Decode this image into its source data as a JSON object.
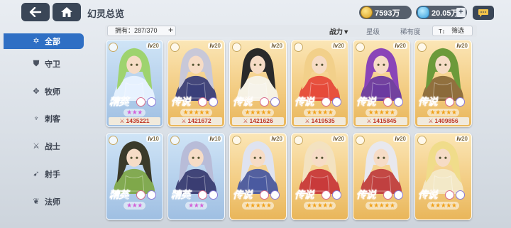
{
  "header": {
    "title": "幻灵总览",
    "gold": "7593万",
    "gems": "20.05万",
    "plus": "+"
  },
  "sidebar": {
    "items": [
      {
        "label": "全部",
        "icon": "all-star-icon",
        "active": true
      },
      {
        "label": "守卫",
        "icon": "shield-icon",
        "active": false
      },
      {
        "label": "牧师",
        "icon": "priest-icon",
        "active": false
      },
      {
        "label": "刺客",
        "icon": "assassin-icon",
        "active": false
      },
      {
        "label": "战士",
        "icon": "warrior-icon",
        "active": false
      },
      {
        "label": "射手",
        "icon": "archer-icon",
        "active": false
      },
      {
        "label": "法师",
        "icon": "mage-icon",
        "active": false
      }
    ]
  },
  "filterbar": {
    "owned": "拥有：287/370",
    "owned_plus": "+",
    "tabs": [
      {
        "label": "战力▼",
        "selected": true
      },
      {
        "label": "星级",
        "selected": false
      },
      {
        "label": "稀有度",
        "selected": false
      }
    ],
    "filter_label": "筛选",
    "filter_icon": "filter-icon"
  },
  "cards": [
    {
      "rank": "精英",
      "tier": "elite",
      "lv_prefix": "lv",
      "level": "20",
      "stars": "★★★",
      "power": "1435221",
      "colors": {
        "hair": "#9ed36f",
        "cloth": "#e8f2ff"
      }
    },
    {
      "rank": "传说",
      "tier": "legend",
      "lv_prefix": "lv",
      "level": "20",
      "stars": "★★★★★",
      "power": "1421672",
      "colors": {
        "hair": "#c8c8d8",
        "cloth": "#3a3f7a"
      }
    },
    {
      "rank": "传说",
      "tier": "legend",
      "lv_prefix": "lv",
      "level": "20",
      "stars": "★★★★★",
      "power": "1421626",
      "colors": {
        "hair": "#2a2a2a",
        "cloth": "#f6f3ea"
      }
    },
    {
      "rank": "传说",
      "tier": "legend",
      "lv_prefix": "lv",
      "level": "20",
      "stars": "★★★★★",
      "power": "1419535",
      "colors": {
        "hair": "#f2d08a",
        "cloth": "#e64a3a"
      }
    },
    {
      "rank": "传说",
      "tier": "legend",
      "lv_prefix": "lv",
      "level": "20",
      "stars": "★★★★★",
      "power": "1415845",
      "colors": {
        "hair": "#8a44b8",
        "cloth": "#6b3aa0"
      }
    },
    {
      "rank": "传说",
      "tier": "legend",
      "lv_prefix": "lv",
      "level": "20",
      "stars": "★★★★★",
      "power": "1409856",
      "colors": {
        "hair": "#6c9a3a",
        "cloth": "#8b6a3a"
      }
    },
    {
      "rank": "精英",
      "tier": "elite",
      "lv_prefix": "lv",
      "level": "10",
      "stars": "★★★",
      "power": "",
      "colors": {
        "hair": "#3a3a2a",
        "cloth": "#7fa84a"
      }
    },
    {
      "rank": "精英",
      "tier": "elite",
      "lv_prefix": "lv",
      "level": "10",
      "stars": "★★★",
      "power": "",
      "colors": {
        "hair": "#b8bcd8",
        "cloth": "#3a3d72"
      }
    },
    {
      "rank": "传说",
      "tier": "legend",
      "lv_prefix": "lv",
      "level": "20",
      "stars": "★★★★★",
      "power": "",
      "colors": {
        "hair": "#dfe3f0",
        "cloth": "#4a5aa0"
      }
    },
    {
      "rank": "传说",
      "tier": "legend",
      "lv_prefix": "lv",
      "level": "20",
      "stars": "★★★★★",
      "power": "",
      "colors": {
        "hair": "#f3e2c0",
        "cloth": "#c83a3a"
      }
    },
    {
      "rank": "传说",
      "tier": "legend",
      "lv_prefix": "lv",
      "level": "20",
      "stars": "★★★★★",
      "power": "",
      "colors": {
        "hair": "#e8e8ee",
        "cloth": "#c04040"
      }
    },
    {
      "rank": "传说",
      "tier": "legend",
      "lv_prefix": "lv",
      "level": "20",
      "stars": "★★★★★",
      "power": "",
      "colors": {
        "hair": "#f0dc8a",
        "cloth": "#f3e9c8"
      }
    }
  ]
}
